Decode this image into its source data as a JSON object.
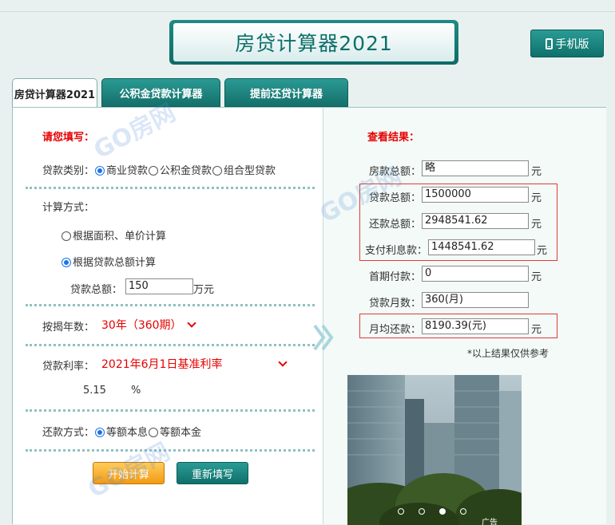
{
  "header": {
    "title": "房贷计算器2021",
    "mobile_label": "手机版"
  },
  "tabs": [
    {
      "label": "房贷计算器2021",
      "active": true
    },
    {
      "label": "公积金贷款计算器",
      "active": false
    },
    {
      "label": "提前还贷计算器",
      "active": false
    }
  ],
  "form": {
    "heading": "请您填写：",
    "loan_type_label": "贷款类别：",
    "loan_types": [
      "商业贷款",
      "公积金贷款",
      "组合型贷款"
    ],
    "calc_method_label": "计算方式：",
    "calc_methods": [
      "根据面积、单价计算",
      "根据贷款总额计算"
    ],
    "loan_total_label": "贷款总额：",
    "loan_total_value": "150",
    "loan_total_unit": "万元",
    "years_label": "按揭年数：",
    "years_value": "30年（360期）",
    "rate_label": "贷款利率：",
    "rate_value": "2021年6月1日基准利率",
    "rate_number": "5.15",
    "rate_unit": "%",
    "repay_label": "还款方式：",
    "repay_methods": [
      "等额本息",
      "等额本金"
    ],
    "calc_button": "开始计算",
    "reset_button": "重新填写"
  },
  "results": {
    "heading": "查看结果：",
    "rows": [
      {
        "label": "房款总额：",
        "value": "略",
        "unit": "元"
      },
      {
        "label": "贷款总额：",
        "value": "1500000",
        "unit": "元"
      },
      {
        "label": "还款总额：",
        "value": "2948541.62",
        "unit": "元"
      },
      {
        "label": "支付利息款：",
        "value": "1448541.62",
        "unit": "元"
      },
      {
        "label": "首期付款：",
        "value": "0",
        "unit": "元"
      },
      {
        "label": "贷款月数：",
        "value": "360(月)",
        "unit": ""
      },
      {
        "label": "月均还款：",
        "value": "8190.39(元)",
        "unit": "元"
      }
    ],
    "note": "*以上结果仅供参考"
  },
  "ad": {
    "label": "广告"
  },
  "watermark": "GO房网",
  "colors": {
    "accent": "#0f6b66",
    "red": "#e60000",
    "orange": "#f29a12"
  }
}
